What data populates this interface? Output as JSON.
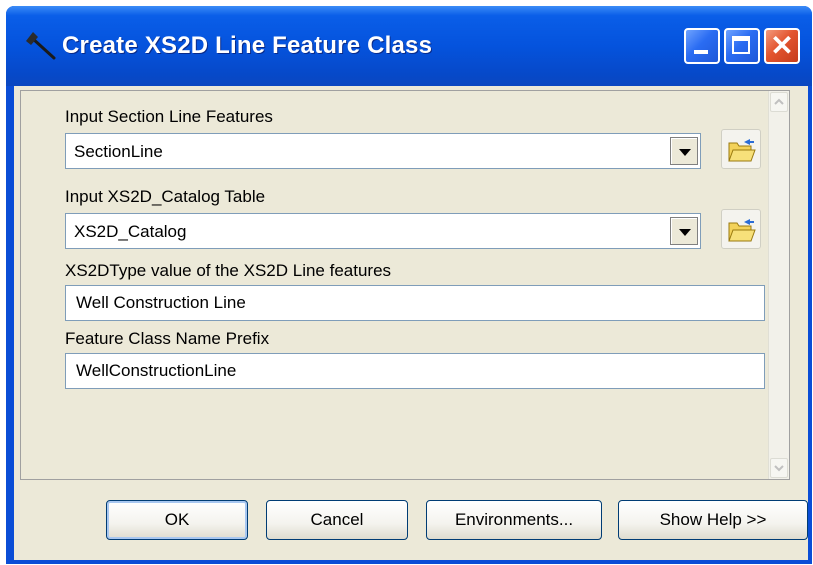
{
  "window": {
    "title": "Create XS2D Line Feature Class"
  },
  "titlebar": {
    "minimize_icon": "minimize-icon",
    "maximize_icon": "maximize-icon",
    "close_icon": "close-icon",
    "accent": "#0553dd",
    "close_color": "#e3552f"
  },
  "form": {
    "section_line_label": "Input Section Line Features",
    "section_line_value": "SectionLine",
    "catalog_label": "Input XS2D_Catalog Table",
    "catalog_value": "XS2D_Catalog",
    "xs2dtype_label": "XS2DType value of the XS2D Line features",
    "xs2dtype_value": "Well Construction Line",
    "prefix_label": "Feature Class Name Prefix",
    "prefix_value": "WellConstructionLine"
  },
  "buttons": {
    "ok": "OK",
    "cancel": "Cancel",
    "environments": "Environments...",
    "show_help": "Show Help >>"
  }
}
